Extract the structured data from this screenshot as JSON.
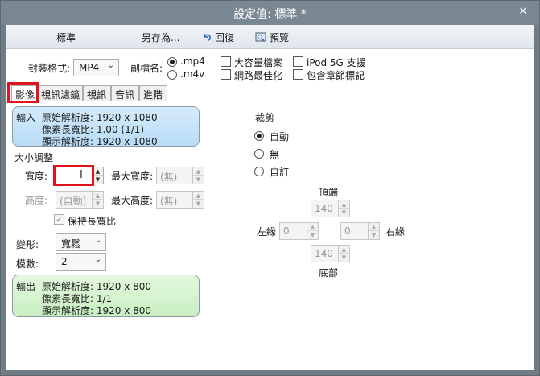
{
  "window": {
    "title": "設定值: 標準 *",
    "close_glyph": "✕"
  },
  "toolbar": {
    "preset_name": "標準",
    "save_as": "另存為...",
    "revert": "回復",
    "preview": "預覽"
  },
  "options": {
    "container_label": "封裝格式:",
    "container_value": "MP4",
    "extension_label": "副檔名:",
    "ext_mp4": ".mp4",
    "ext_m4v": ".m4v",
    "large_file": "大容量檔案",
    "web_optimized": "網路最佳化",
    "ipod_5g": "iPod 5G 支援",
    "chapter_markers": "包含章節標記"
  },
  "tabs": [
    {
      "label": "影像"
    },
    {
      "label": "視訊濾鏡"
    },
    {
      "label": "視訊"
    },
    {
      "label": "音訊"
    },
    {
      "label": "進階"
    }
  ],
  "input_info": {
    "heading": "輸入",
    "storage_resolution": "原始解析度: 1920 x 1080",
    "pixel_aspect": "像素長寬比: 1.00 (1/1)",
    "display_resolution": "顯示解析度: 1920 x 1080"
  },
  "size": {
    "heading": "大小調整",
    "width_label": "寬度:",
    "width_value": "",
    "height_label": "高度:",
    "height_placeholder": "(自動)",
    "max_width_label": "最大寬度:",
    "max_width_placeholder": "(無)",
    "max_height_label": "最大高度:",
    "max_height_placeholder": "(無)",
    "keep_aspect": "保持長寬比",
    "anamorphic_label": "變形:",
    "anamorphic_value": "寬鬆",
    "modulus_label": "模數:",
    "modulus_value": "2"
  },
  "output_info": {
    "heading": "輸出",
    "storage_resolution": "原始解析度: 1920 x 800",
    "pixel_aspect": "像素長寬比: 1/1",
    "display_resolution": "顯示解析度: 1920 x 800"
  },
  "crop": {
    "heading": "裁剪",
    "auto": "自動",
    "none": "無",
    "custom": "自訂",
    "top_label": "頂端",
    "top_value": "140",
    "left_label": "左緣",
    "left_value": "0",
    "right_label": "右緣",
    "right_value": "0",
    "bottom_label": "底部",
    "bottom_value": "140"
  },
  "colors": {
    "highlight": "#e0131c",
    "title_bar": "#7a8893",
    "input_box": "#c6e3f8",
    "output_box": "#d4f3cd"
  }
}
